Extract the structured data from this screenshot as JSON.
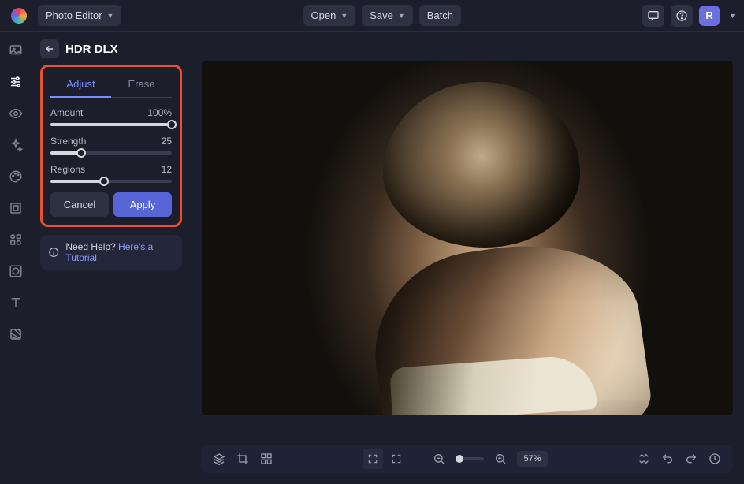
{
  "header": {
    "app_name": "Photo Editor",
    "open_label": "Open",
    "save_label": "Save",
    "batch_label": "Batch",
    "avatar_letter": "R"
  },
  "panel": {
    "title": "HDR DLX",
    "tabs": {
      "adjust": "Adjust",
      "erase": "Erase"
    },
    "sliders": {
      "amount": {
        "label": "Amount",
        "value": "100%",
        "percent": 100
      },
      "strength": {
        "label": "Strength",
        "value": "25",
        "percent": 25
      },
      "regions": {
        "label": "Regions",
        "value": "12",
        "percent": 44
      }
    },
    "cancel": "Cancel",
    "apply": "Apply",
    "help_prefix": "Need Help? ",
    "help_link": "Here's a Tutorial"
  },
  "bottom": {
    "zoom": "57%"
  }
}
